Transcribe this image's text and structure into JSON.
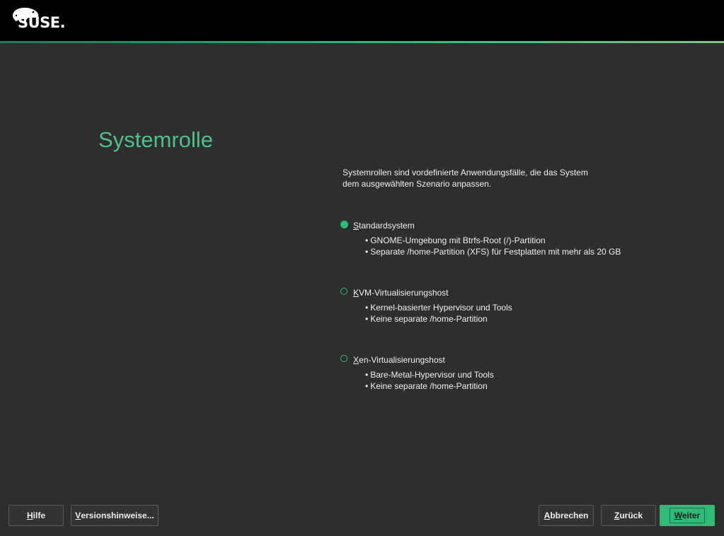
{
  "header": {
    "logo_text": "SUSE."
  },
  "page": {
    "title": "Systemrolle",
    "intro_line1": "Systemrollen sind vordefinierte Anwendungsfälle, die das System",
    "intro_line2": "dem ausgewählten Szenario anpassen."
  },
  "roles": [
    {
      "mnemonic": "S",
      "rest": "tandardsystem",
      "selected": true,
      "bullets": [
        "GNOME-Umgebung mit Btrfs-Root (/)-Partition",
        "Separate /home-Partition (XFS) für Festplatten mit mehr als 20 GB"
      ]
    },
    {
      "mnemonic": "K",
      "rest": "VM-Virtualisierungshost",
      "selected": false,
      "bullets": [
        "Kernel-basierter Hypervisor und Tools",
        "Keine separate /home-Partition"
      ]
    },
    {
      "mnemonic": "X",
      "rest": "en-Virtualisierungshost",
      "selected": false,
      "bullets": [
        "Bare-Metal-Hypervisor und Tools",
        "Keine separate /home-Partition"
      ]
    }
  ],
  "buttons": {
    "help": {
      "mnemonic": "H",
      "rest": "ilfe"
    },
    "release_notes": {
      "mnemonic": "V",
      "rest": "ersionshinweise..."
    },
    "abort": {
      "mnemonic": "A",
      "rest": "bbrechen"
    },
    "back": {
      "mnemonic": "Z",
      "rest": "urück"
    },
    "next": {
      "mnemonic": "W",
      "rest": "eiter"
    }
  },
  "colors": {
    "accent": "#30ba78",
    "title": "#4fbf8c",
    "background": "#2e2e2e",
    "topbar": "#000000"
  }
}
